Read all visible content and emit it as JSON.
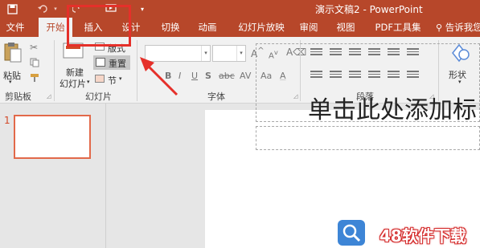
{
  "titlebar": {
    "title": "演示文稿2 - PowerPoint",
    "color": "#b7472a"
  },
  "tabs": [
    "文件",
    "开始",
    "插入",
    "设计",
    "切换",
    "动画",
    "幻灯片放映",
    "审阅",
    "视图",
    "PDF工具集",
    "告诉我您"
  ],
  "active_tab": "开始",
  "ribbon": {
    "clipboard": {
      "paste": "粘贴",
      "group": "剪贴板"
    },
    "slides": {
      "new_slide_line1": "新建",
      "new_slide_line2": "幻灯片",
      "layout": "版式",
      "reset": "重置",
      "section": "节",
      "group": "幻灯片"
    },
    "font": {
      "group": "字体"
    },
    "paragraph": {
      "group": "段落"
    },
    "drawing": {
      "shapes": "形状"
    }
  },
  "thumbnails": {
    "slide_number": "1"
  },
  "slide": {
    "title_placeholder": "单击此处添加标"
  },
  "watermark": {
    "text": "48软件下载"
  },
  "colors": {
    "accent": "#b7472a",
    "annotation": "#e5302a"
  }
}
